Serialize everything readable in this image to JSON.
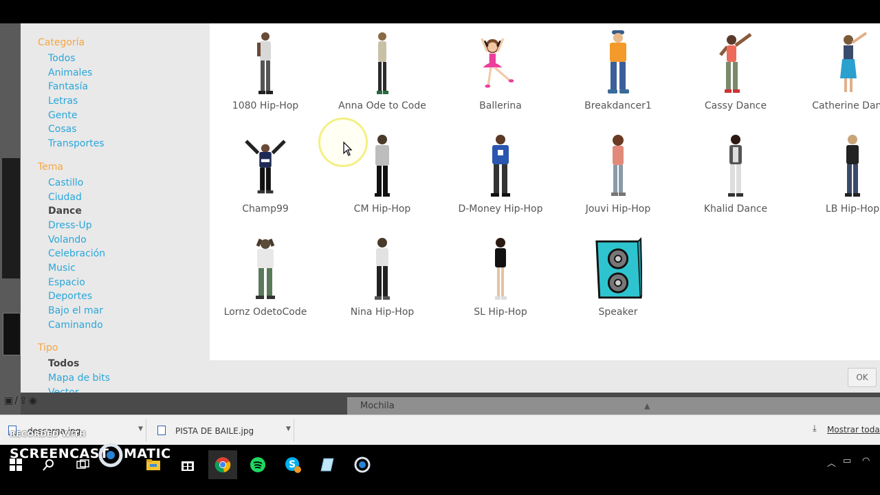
{
  "sidebar": {
    "category": {
      "title": "Categoría",
      "items": [
        "Todos",
        "Animales",
        "Fantasía",
        "Letras",
        "Gente",
        "Cosas",
        "Transportes"
      ]
    },
    "theme": {
      "title": "Tema",
      "items": [
        "Castillo",
        "Ciudad",
        "Dance",
        "Dress-Up",
        "Volando",
        "Celebración",
        "Music",
        "Espacio",
        "Deportes",
        "Bajo el mar",
        "Caminando"
      ],
      "selected": "Dance"
    },
    "type": {
      "title": "Tipo",
      "items": [
        "Todos",
        "Mapa de bits",
        "Vector"
      ],
      "selected": "Todos"
    }
  },
  "sprites": [
    {
      "name": "1080 Hip-Hop"
    },
    {
      "name": "Anna Ode to Code"
    },
    {
      "name": "Ballerina"
    },
    {
      "name": "Breakdancer1"
    },
    {
      "name": "Cassy Dance"
    },
    {
      "name": "Catherine Dance"
    },
    {
      "name": "Champ99"
    },
    {
      "name": "CM Hip-Hop"
    },
    {
      "name": "D-Money Hip-Hop"
    },
    {
      "name": "Jouvi Hip-Hop"
    },
    {
      "name": "Khalid Dance"
    },
    {
      "name": "LB Hip-Hop"
    },
    {
      "name": "Lornz OdetoCode"
    },
    {
      "name": "Nina Hip-Hop"
    },
    {
      "name": "SL Hip-Hop"
    },
    {
      "name": "Speaker"
    }
  ],
  "modal": {
    "ok_label": "OK"
  },
  "editor": {
    "backpack_label": "Mochila"
  },
  "downloads": {
    "items": [
      {
        "filename": "descarga.jpg"
      },
      {
        "filename": "PISTA DE BAILE.jpg"
      }
    ],
    "show_all": "Mostrar todas"
  },
  "watermark": {
    "line1": "RECORDED WITH",
    "line2a": "SCREENCAST",
    "line2b": "MATIC"
  },
  "colors": {
    "link": "#2aa6d9",
    "section": "#f7a53e",
    "speaker": "#2ec4cf"
  }
}
